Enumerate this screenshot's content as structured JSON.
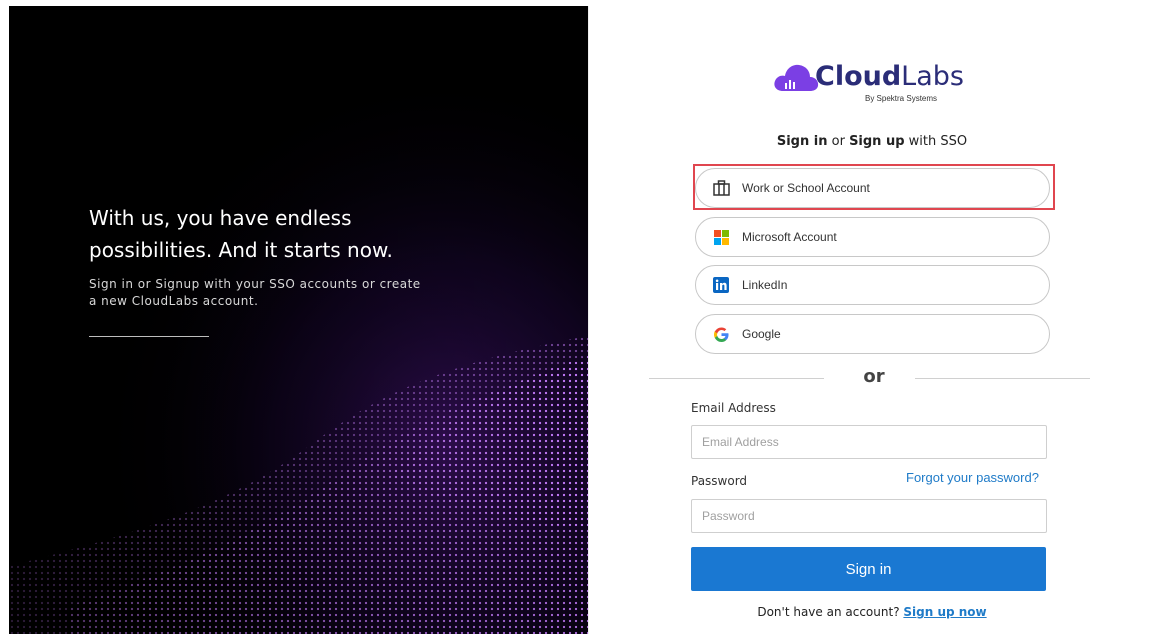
{
  "hero": {
    "heading_line1": "With us, you have endless",
    "heading_line2": "possibilities. And it starts now.",
    "subtext_line1": "Sign in or Signup with your SSO accounts or create",
    "subtext_line2": "a new CloudLabs account."
  },
  "logo": {
    "word_bold": "Cloud",
    "word_light": "Labs",
    "tagline": "By Spektra Systems"
  },
  "sso": {
    "title_part1": "Sign in",
    "title_part2": " or ",
    "title_part3": "Sign up",
    "title_part4": " with SSO",
    "buttons": [
      {
        "label": "Work or School Account",
        "icon": "briefcase-icon"
      },
      {
        "label": "Microsoft Account",
        "icon": "microsoft-icon"
      },
      {
        "label": "LinkedIn",
        "icon": "linkedin-icon"
      },
      {
        "label": "Google",
        "icon": "google-icon"
      }
    ]
  },
  "divider": {
    "text": "or"
  },
  "form": {
    "email_label": "Email Address",
    "email_placeholder": "Email Address",
    "email_value": "",
    "password_label": "Password",
    "password_placeholder": "Password",
    "password_value": "",
    "forgot_link": "Forgot your password?",
    "signin_button": "Sign in"
  },
  "signup": {
    "prompt": "Don't have an account?",
    "link": "Sign up now"
  },
  "colors": {
    "primary": "#1a78d2",
    "link": "#1f7bc8",
    "brand": "#2b2d78",
    "brand_accent": "#7b3fe4",
    "highlight": "#e0464f",
    "hero_bg": "#000000"
  }
}
